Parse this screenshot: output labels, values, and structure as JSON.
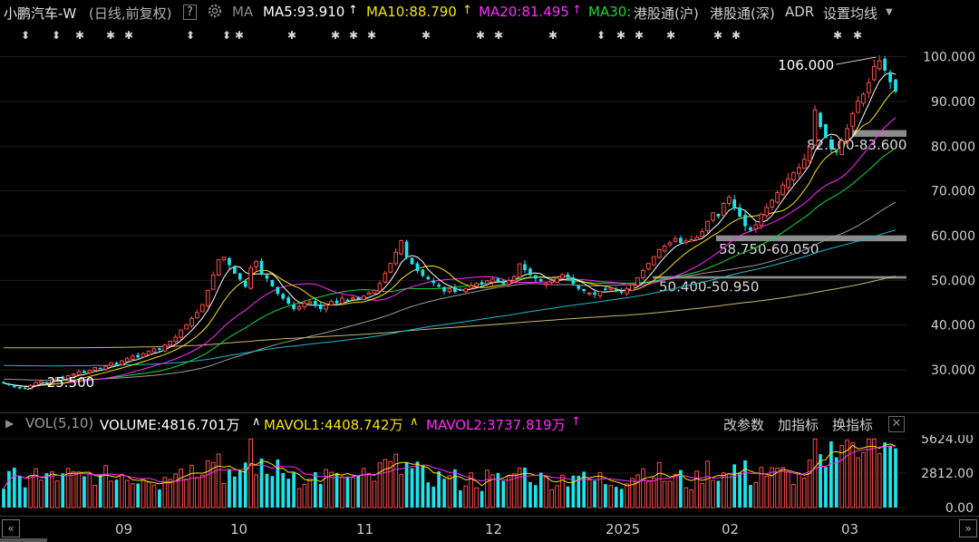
{
  "header": {
    "title": "小鹏汽车-W",
    "mode": "(日线,前复权)",
    "help_label": "?",
    "gear_icon": "gear-icon",
    "ma_label": "MA",
    "ma5": "MA5:93.910",
    "ma10": "MA10:88.790",
    "ma20": "MA20:81.495",
    "ma30": "MA30:",
    "sh_connect": "港股通(沪)",
    "sz_connect": "港股通(深)",
    "adr": "ADR",
    "settings": "设置均线",
    "up_arrow": "↑",
    "dropdown_icon": "caret-down-icon"
  },
  "colors": {
    "up": "#ff4a4a",
    "down": "#19e6f0",
    "ma5": "#ffffff",
    "ma10": "#f5e500",
    "ma20": "#ff2bff",
    "ma30": "#17d832",
    "ma60": "#9a9a9a",
    "ma120": "#1fb9c8",
    "ma250": "#c8b86a"
  },
  "chart_data": [
    {
      "type": "candlestick",
      "y_axis_ticks": [
        "100.000",
        "90.000",
        "80.000",
        "70.000",
        "60.000",
        "50.000",
        "40.000",
        "30.000"
      ],
      "ylim": [
        20.9,
        107.0
      ],
      "annotations": {
        "high_label": "106.000",
        "low_label": "25.500",
        "zones": [
          {
            "label": "82.100-83.600",
            "low": 82.1,
            "high": 83.6
          },
          {
            "label": "58.750-60.050",
            "low": 58.75,
            "high": 60.05
          },
          {
            "label": "50.400-50.950",
            "low": 50.4,
            "high": 50.95
          }
        ]
      },
      "event_markers": [
        "⬍",
        "⬍",
        "✱",
        "✱",
        "✱",
        "⬍",
        "⬍",
        "✱",
        "✱",
        "✱",
        "✱",
        "✱",
        "✱",
        "✱",
        "✱",
        "✱",
        "⬍",
        "✱",
        "✱",
        "✱",
        "✱",
        "✱",
        "✱",
        "✱"
      ],
      "closes": [
        27.0,
        26.6,
        26.2,
        26.0,
        25.8,
        26.5,
        27.2,
        27.4,
        27.1,
        27.8,
        28.3,
        28.0,
        28.7,
        29.1,
        29.6,
        29.3,
        29.9,
        30.5,
        30.2,
        30.8,
        31.6,
        31.2,
        32.0,
        32.5,
        33.1,
        32.8,
        33.6,
        34.2,
        34.7,
        34.5,
        35.6,
        36.4,
        37.3,
        38.9,
        40.1,
        41.5,
        42.8,
        44.6,
        47.8,
        51.2,
        54.6,
        55.2,
        53.4,
        51.5,
        50.2,
        48.6,
        52.8,
        54.2,
        51.3,
        50.4,
        48.7,
        47.0,
        45.9,
        44.8,
        43.6,
        44.1,
        44.9,
        45.2,
        44.3,
        43.6,
        44.5,
        45.3,
        44.9,
        46.0,
        45.5,
        46.1,
        45.7,
        46.5,
        47.2,
        47.8,
        49.3,
        51.6,
        53.8,
        56.3,
        58.9,
        55.2,
        53.6,
        52.1,
        51.0,
        50.2,
        49.4,
        48.6,
        47.5,
        48.1,
        47.4,
        47.7,
        48.2,
        48.8,
        49.3,
        49.1,
        49.9,
        50.3,
        49.7,
        49.2,
        50.0,
        50.8,
        53.7,
        52.3,
        51.2,
        50.4,
        49.8,
        49.3,
        49.9,
        50.5,
        51.3,
        50.6,
        49.2,
        48.1,
        47.6,
        47.2,
        46.8,
        47.5,
        47.9,
        48.3,
        47.7,
        47.3,
        48.1,
        49.0,
        50.6,
        52.2,
        53.8,
        55.3,
        56.9,
        57.7,
        58.4,
        59.3,
        58.4,
        58.8,
        59.1,
        59.6,
        60.9,
        63.2,
        65.1,
        64.3,
        67.2,
        68.6,
        66.1,
        64.2,
        62.1,
        61.2,
        62.4,
        64.8,
        66.3,
        67.9,
        69.6,
        71.3,
        72.7,
        74.1,
        75.2,
        77.1,
        79.8,
        88.1,
        84.3,
        81.8,
        79.4,
        78.6,
        81.2,
        83.9,
        87.3,
        90.1,
        91.6,
        94.2,
        97.8,
        99.1,
        96.9,
        94.3,
        92.2
      ]
    },
    {
      "type": "bar",
      "title": "VOL(5,10)",
      "volume_label": "VOLUME:4816.701万",
      "mavol1_label": "MAVOL1:4408.742万",
      "mavol2_label": "MAVOL2:3737.819万",
      "y_axis_ticks": [
        "5624.00",
        "2812.00",
        "0.00"
      ],
      "ylim": [
        0,
        5624
      ]
    }
  ],
  "volume_panel": {
    "close_icon": "close-icon",
    "buttons": {
      "params": "改参数",
      "add": "加指标",
      "switch": "换指标"
    }
  },
  "x_axis": {
    "months": [
      "09",
      "10",
      "11",
      "12",
      "2025",
      "02",
      "03"
    ],
    "scroll_left": "«",
    "scroll_right": "»"
  }
}
